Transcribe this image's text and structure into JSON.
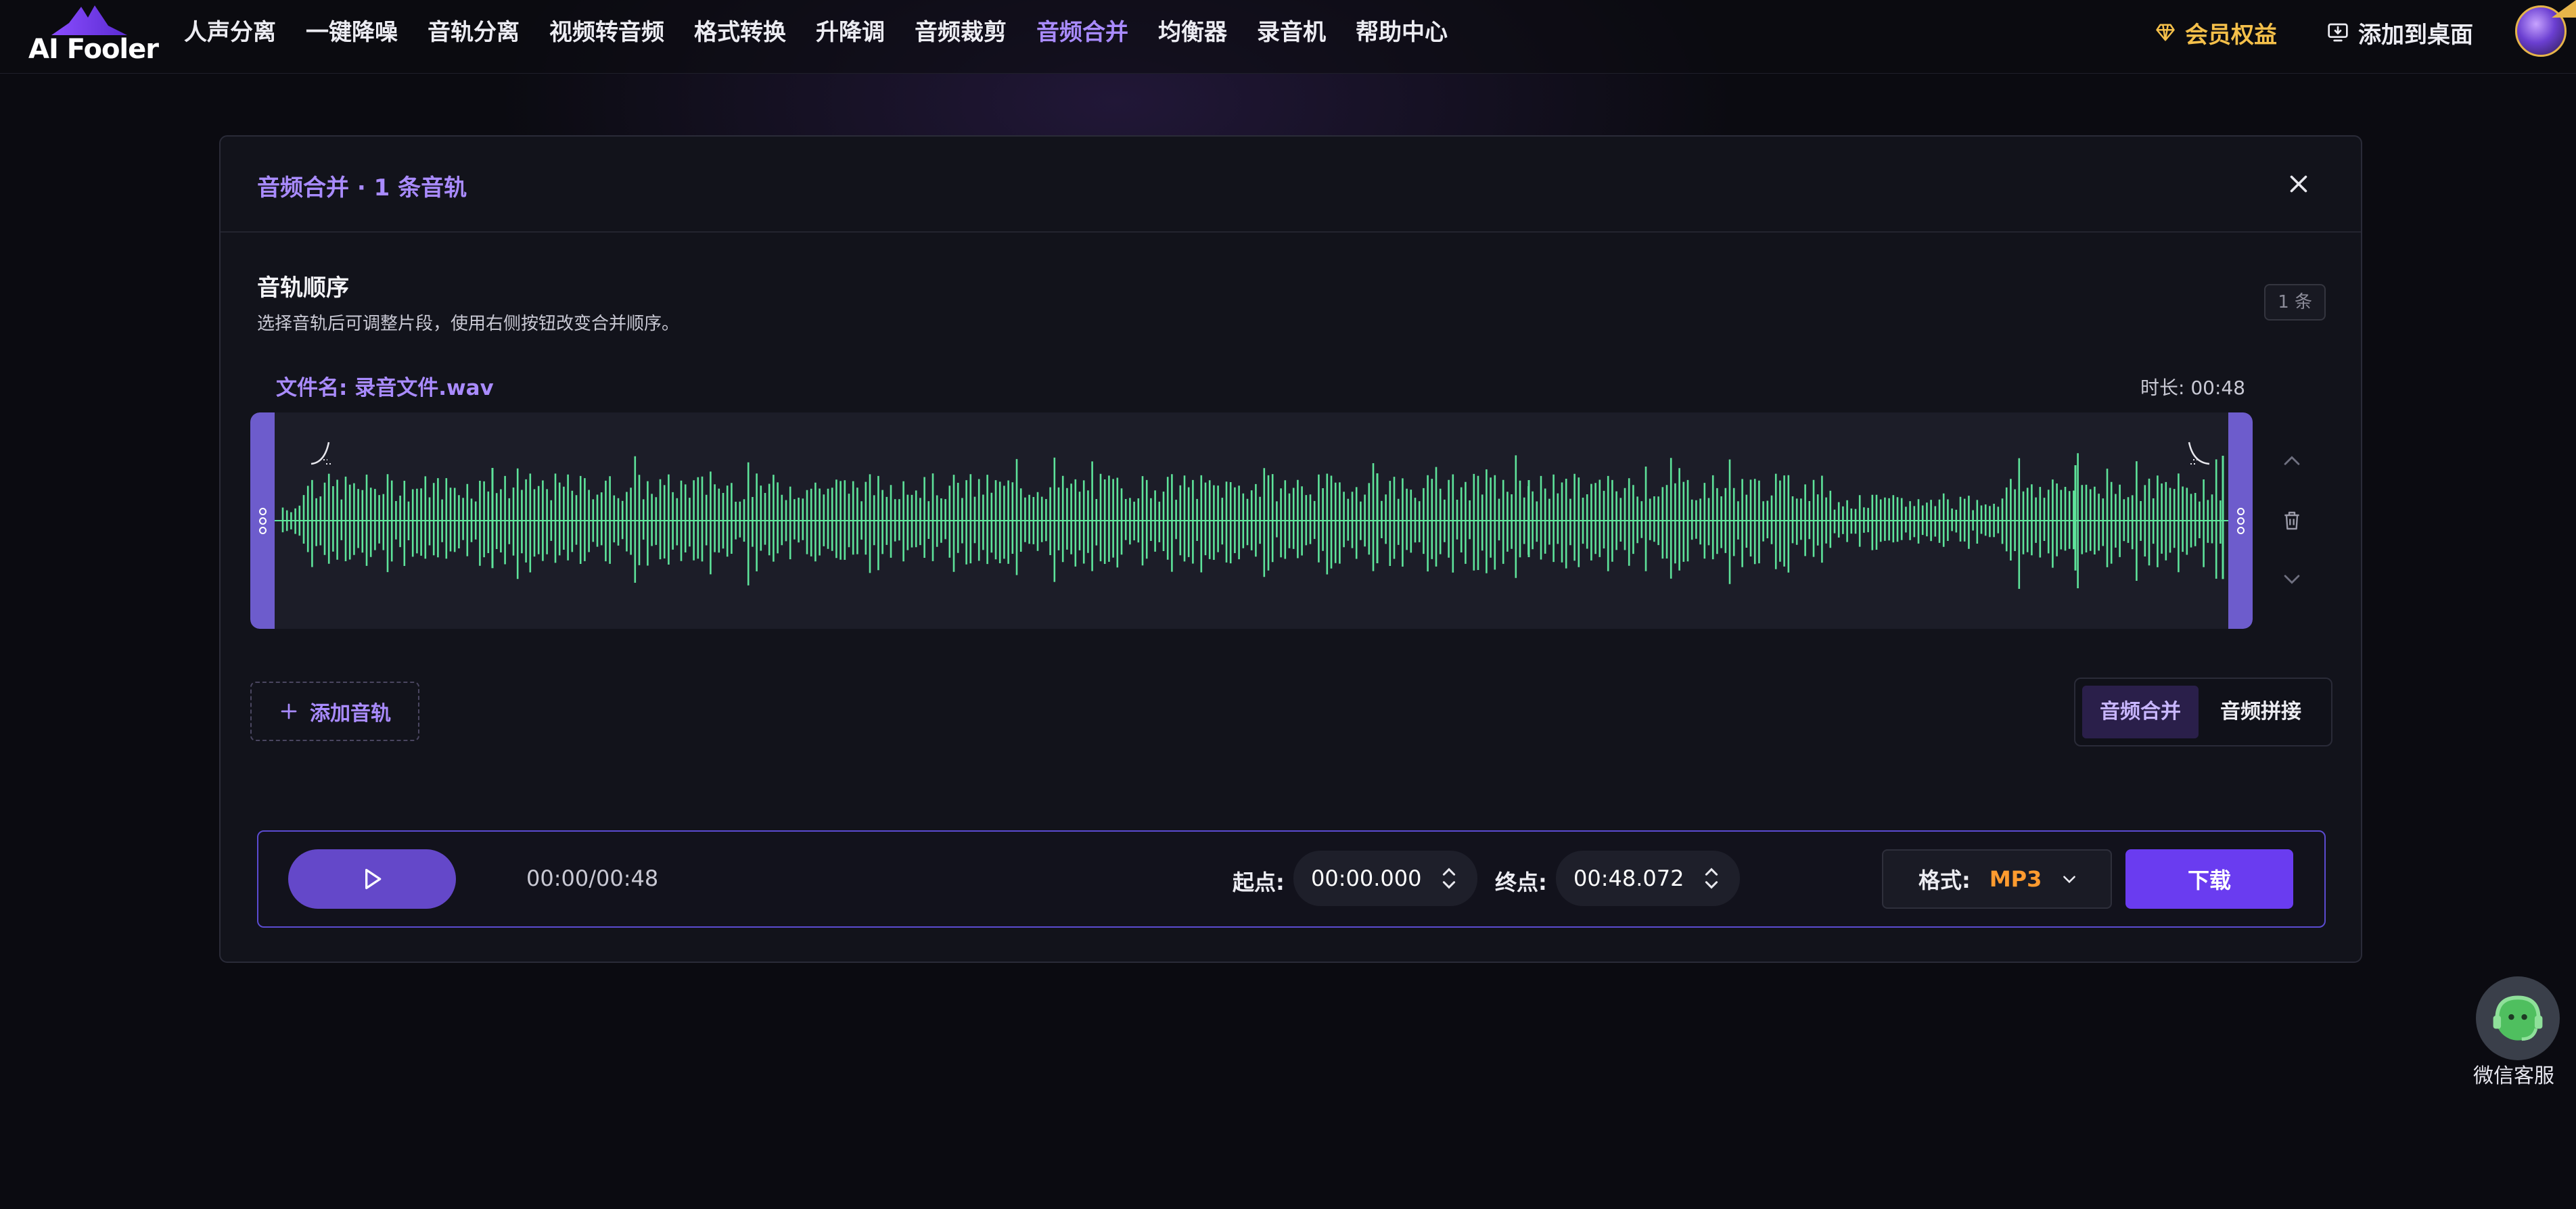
{
  "app": {
    "logo_text": "AI Fooler"
  },
  "nav": {
    "items": [
      {
        "label": "人声分离"
      },
      {
        "label": "一键降噪"
      },
      {
        "label": "音轨分离"
      },
      {
        "label": "视频转音频"
      },
      {
        "label": "格式转换"
      },
      {
        "label": "升降调"
      },
      {
        "label": "音频裁剪"
      },
      {
        "label": "音频合并"
      },
      {
        "label": "均衡器"
      },
      {
        "label": "录音机"
      },
      {
        "label": "帮助中心"
      }
    ],
    "active_index": 7,
    "vip_label": "会员权益",
    "desktop_label": "添加到桌面"
  },
  "panel": {
    "title": "音频合并 · 1 条音轨",
    "section_title": "音轨顺序",
    "section_desc": "选择音轨后可调整片段，使用右侧按钮改变合并顺序。",
    "count_badge": "1 条"
  },
  "track": {
    "file_name": "文件名: 录音文件.wav",
    "duration": "时长: 00:48",
    "wave_color": "#5ee39a",
    "handle_color": "#6d5ccc"
  },
  "actions": {
    "add_track": "添加音轨",
    "modes": [
      {
        "label": "音频合并",
        "active": true
      },
      {
        "label": "音频拼接",
        "active": false
      }
    ]
  },
  "player": {
    "time": "00:00/00:48",
    "start_label": "起点:",
    "start_value": "00:00.000",
    "end_label": "终点:",
    "end_value": "00:48.072",
    "format_label": "格式:",
    "format_value": "MP3",
    "download_label": "下载"
  },
  "service": {
    "label": "微信客服"
  },
  "colors": {
    "accent": "#a98bff",
    "button": "#6a3cf0",
    "vip": "#f5c04a",
    "format": "#ff9b2f"
  }
}
